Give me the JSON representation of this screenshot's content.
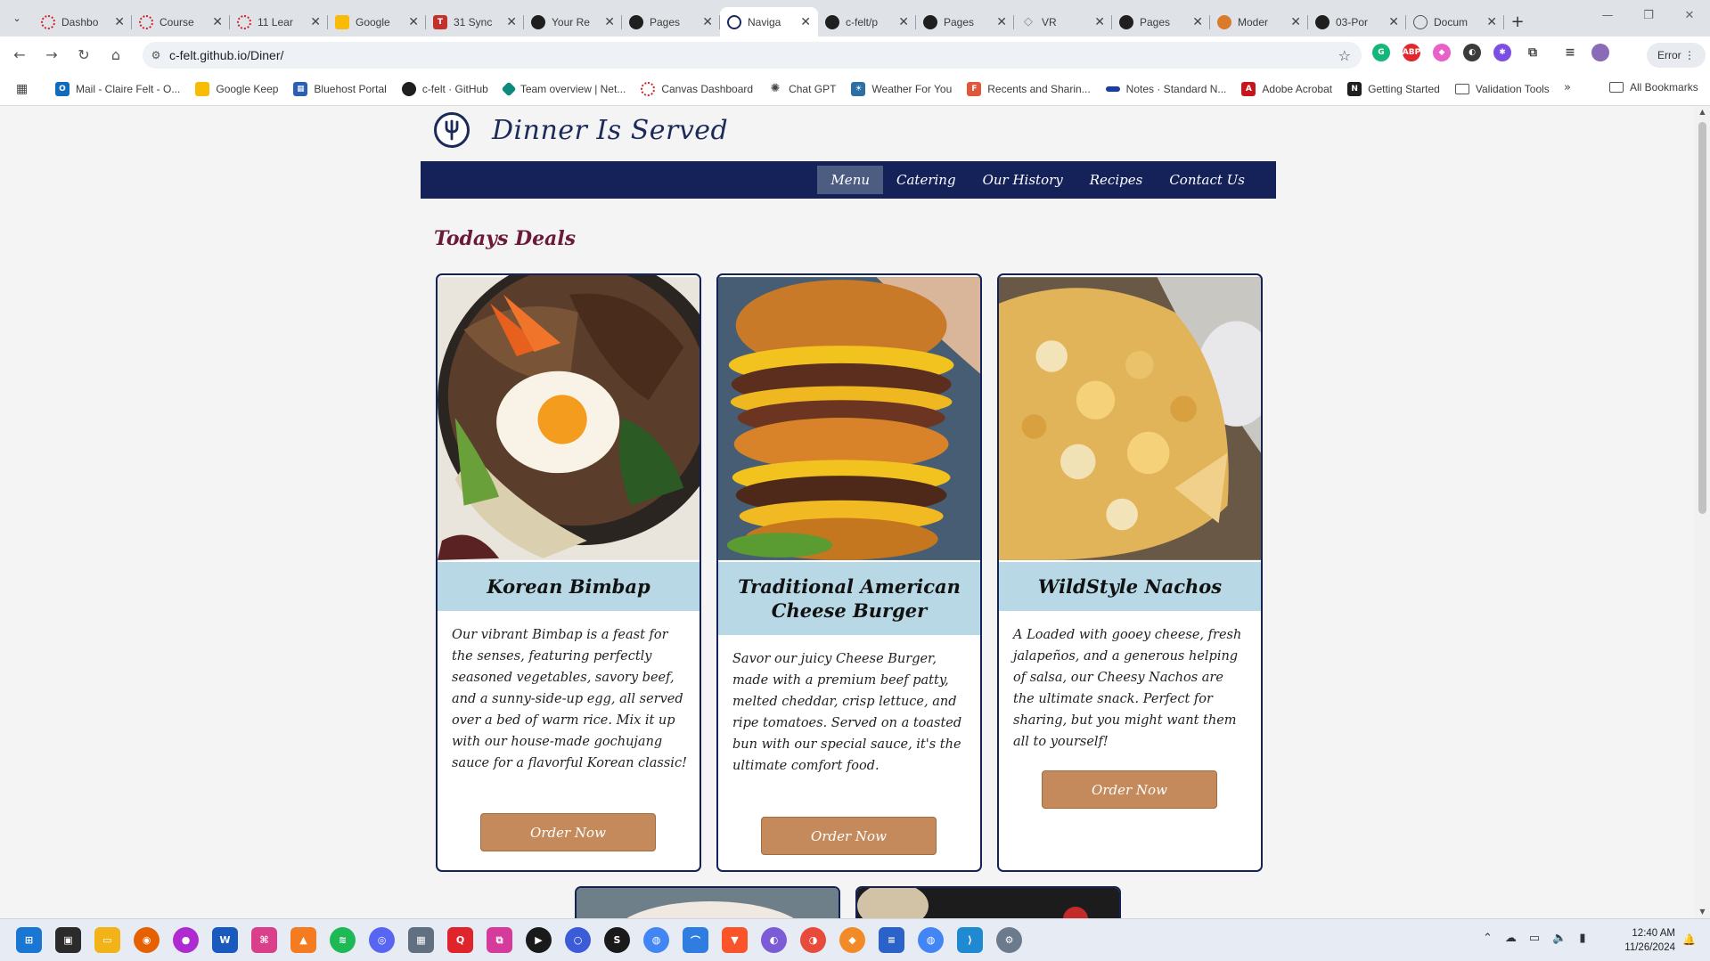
{
  "browser": {
    "tabs": [
      {
        "title": "Dashbo",
        "favicon": "canvas-icon"
      },
      {
        "title": "Course",
        "favicon": "canvas-icon"
      },
      {
        "title": "11 Lear",
        "favicon": "canvas-icon"
      },
      {
        "title": "Google",
        "favicon": "keep-icon"
      },
      {
        "title": "31 Sync",
        "favicon": "sync-icon"
      },
      {
        "title": "Your Re",
        "favicon": "github-icon"
      },
      {
        "title": "Pages",
        "favicon": "github-icon"
      },
      {
        "title": "Naviga",
        "favicon": "site-icon",
        "active": true
      },
      {
        "title": "c-felt/p",
        "favicon": "github-icon"
      },
      {
        "title": "Pages",
        "favicon": "github-icon"
      },
      {
        "title": "VR",
        "favicon": "vr-icon"
      },
      {
        "title": "Pages",
        "favicon": "github-icon"
      },
      {
        "title": "Moder",
        "favicon": "modern-icon"
      },
      {
        "title": "03-Por",
        "favicon": "github-icon"
      },
      {
        "title": "Docum",
        "favicon": "globe-icon"
      }
    ],
    "url": "c-felt.github.io/Diner/",
    "profile_button": "Error",
    "bookmarks": [
      {
        "label": "Mail - Claire Felt - O...",
        "color": "#0f6cbd"
      },
      {
        "label": "Google Keep",
        "color": "#f9bc05"
      },
      {
        "label": "Bluehost Portal",
        "color": "#2b5fb4"
      },
      {
        "label": "c-felt · GitHub",
        "color": "#1f1f1f"
      },
      {
        "label": "Team overview | Net...",
        "color": "#0a8a7a"
      },
      {
        "label": "Canvas Dashboard",
        "color": "#d2232a"
      },
      {
        "label": "Chat GPT",
        "color": "#444444"
      },
      {
        "label": "Weather For You",
        "color": "#2d6fa3"
      },
      {
        "label": "Recents and Sharin...",
        "color": "#e0573b"
      },
      {
        "label": "Notes · Standard N...",
        "color": "#1b3fa0"
      },
      {
        "label": "Adobe Acrobat",
        "color": "#c4161c"
      },
      {
        "label": "Getting Started",
        "color": "#1f1f1f"
      },
      {
        "label": "Validation Tools",
        "color": "#555555"
      }
    ],
    "all_bookmarks": "All Bookmarks"
  },
  "site": {
    "title": "Dinner Is Served",
    "nav": [
      "Menu",
      "Catering",
      "Our History",
      "Recipes",
      "Contact Us"
    ],
    "active_nav": "Menu",
    "section_title": "Todays Deals",
    "deals": [
      {
        "name": "Korean Bimbap",
        "description": "Our vibrant Bimbap is a feast for the senses, featuring perfectly seasoned vegetables, savory beef, and a sunny-side-up egg, all served over a bed of warm rice. Mix it up with our house-made gochujang sauce for a flavorful Korean classic!",
        "button": "Order Now"
      },
      {
        "name": "Traditional American Cheese Burger",
        "description": "Savor our juicy Cheese Burger, made with a premium beef patty, melted cheddar, crisp lettuce, and ripe tomatoes. Served on a toasted bun with our special sauce, it's the ultimate comfort food.",
        "button": "Order Now"
      },
      {
        "name": "WildStyle Nachos",
        "description": "A Loaded with gooey cheese, fresh jalapeños, and a generous helping of salsa, our Cheesy Nachos are the ultimate snack. Perfect for sharing, but you might want them all to yourself!",
        "button": "Order Now"
      }
    ]
  },
  "taskbar": {
    "time": "12:40 AM",
    "date": "11/26/2024"
  },
  "colors": {
    "nav_bg": "#152259",
    "card_title_bg": "#b7d8e4",
    "button_bg": "#c48a5c",
    "section_title": "#6b1a3a"
  }
}
